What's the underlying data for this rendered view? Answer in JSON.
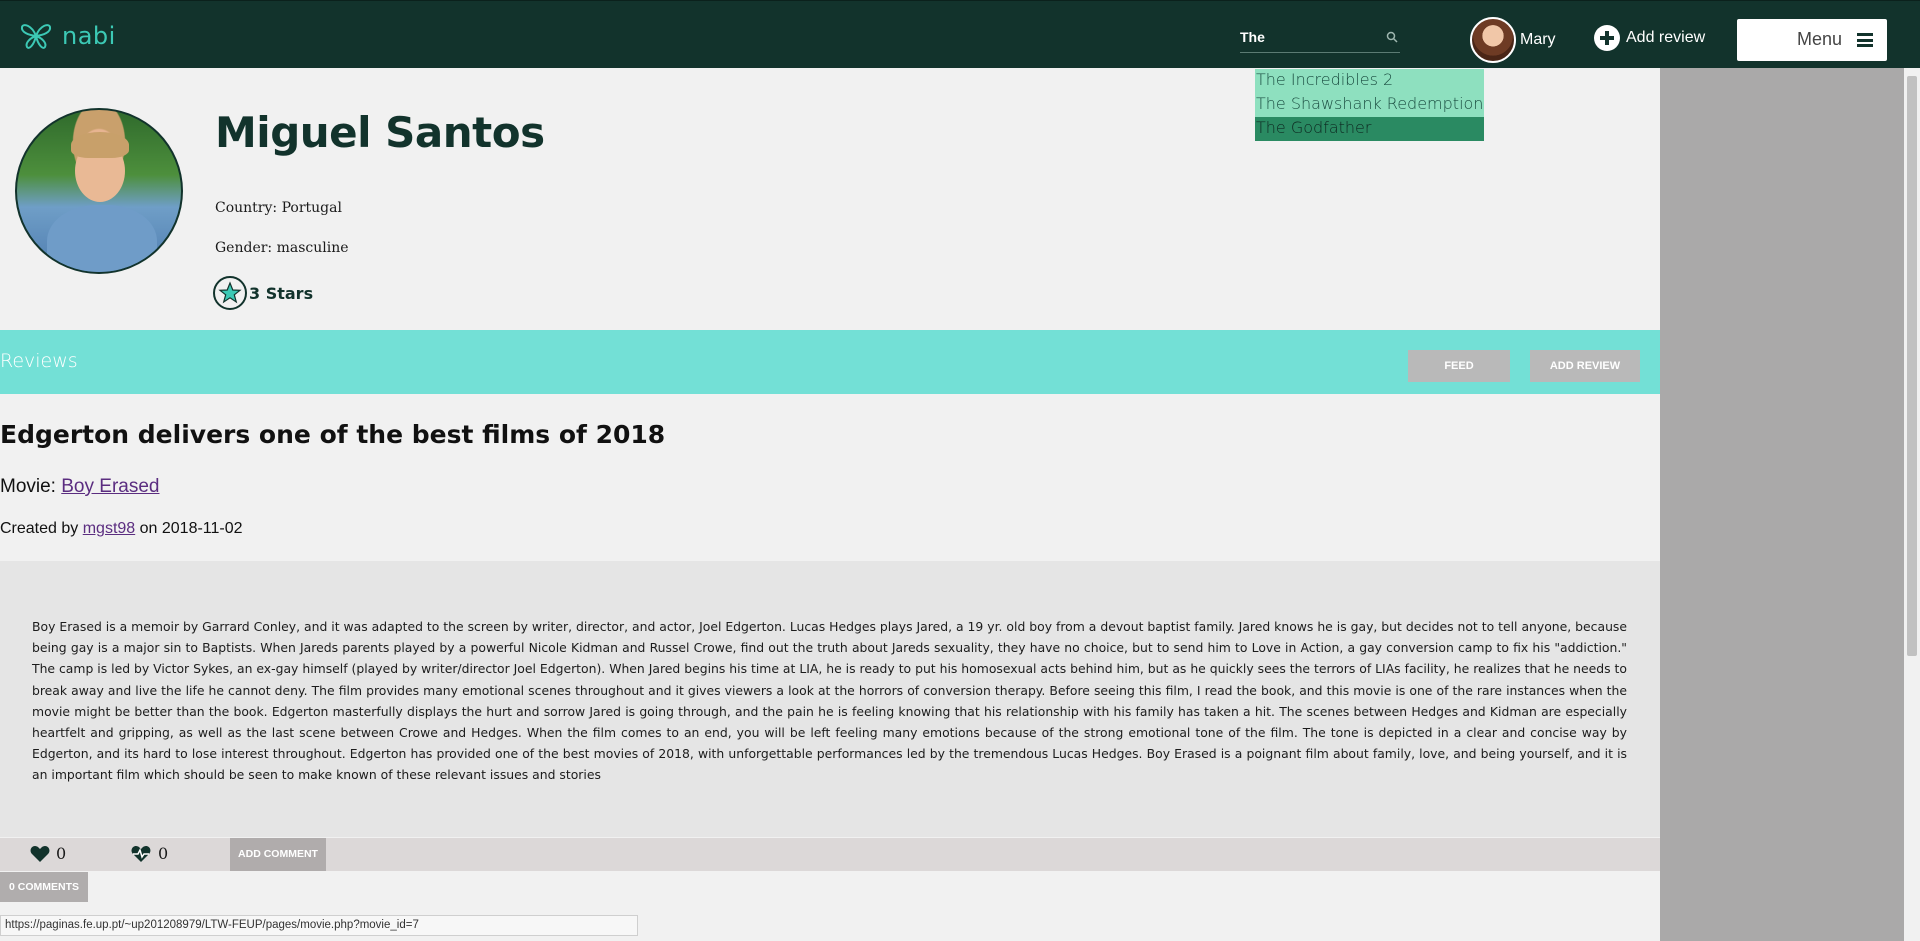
{
  "brand": {
    "name": "nabi"
  },
  "search": {
    "value": "The"
  },
  "user": {
    "name": "Mary"
  },
  "nav": {
    "add_review": "Add review",
    "menu": "Menu"
  },
  "search_results": [
    "The Incredibles 2",
    "The Shawshank Redemption",
    "The Godfather"
  ],
  "profile": {
    "name": "Miguel Santos",
    "country": "Country: Portugal",
    "gender": "Gender: masculine",
    "stars": "3 Stars"
  },
  "reviews_bar": {
    "title": "Reviews",
    "feed": "FEED",
    "add_review": "ADD REVIEW"
  },
  "review": {
    "title": "Edgerton delivers one of the best films of 2018",
    "movie_prefix": "Movie: ",
    "movie": "Boy Erased",
    "created_prefix": "Created by ",
    "author": "mgst98",
    "date_prefix": " on ",
    "date": "2018-11-02",
    "body": "Boy Erased is a memoir by Garrard Conley, and it was adapted to the screen by writer, director, and actor, Joel Edgerton. Lucas Hedges plays Jared, a 19 yr. old boy from a devout baptist family. Jared knows he is gay, but decides not to tell anyone, because being gay is a major sin to Baptists. When Jareds parents played by a powerful Nicole Kidman and Russel Crowe, find out the truth about Jareds sexuality, they have no choice, but to send him to Love in Action, a gay conversion camp to fix his \"addiction.\" The camp is led by Victor Sykes, an ex-gay himself (played by writer/director Joel Edgerton). When Jared begins his time at LIA, he is ready to put his homosexual acts behind him, but as he quickly sees the terrors of LIAs facility, he realizes that he needs to break away and live the life he cannot deny. The film provides many emotional scenes throughout and it gives viewers a look at the horrors of conversion therapy. Before seeing this film, I read the book, and this movie is one of the rare instances when the movie might be better than the book. Edgerton masterfully displays the hurt and sorrow Jared is going through, and the pain he is feeling knowing that his relationship with his family has taken a hit. The scenes between Hedges and Kidman are especially heartfelt and gripping, as well as the last scene between Crowe and Hedges. When the film comes to an end, you will be left feeling many emotions because of the strong emotional tone of the film. The tone is depicted in a clear and concise way by Edgerton, and its hard to lose interest throughout. Edgerton has provided one of the best movies of 2018, with unforgettable performances led by the tremendous Lucas Hedges. Boy Erased is a poignant film about family, love, and being yourself, and it is an important film which should be seen to make known of these relevant issues and stories",
    "likes": "0",
    "health_likes": "0",
    "add_comment": "ADD COMMENT",
    "comments": "0 COMMENTS"
  },
  "status_url": "https://paginas.fe.up.pt/~up201208979/LTW-FEUP/pages/movie.php?movie_id=7",
  "colors": {
    "topbar": "#12332c",
    "accent": "#73e0d6",
    "brand": "#3cc9b5"
  }
}
